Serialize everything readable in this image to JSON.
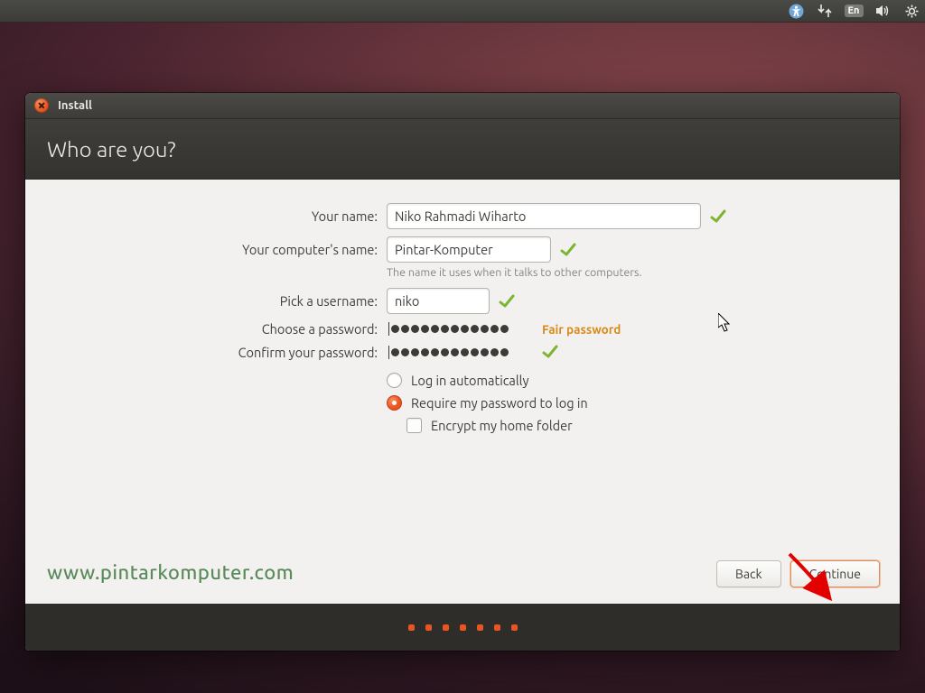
{
  "panel": {
    "lang": "En"
  },
  "window": {
    "title": "Install",
    "header": "Who are you?"
  },
  "form": {
    "name_label": "Your name:",
    "name_value": "Niko Rahmadi Wiharto",
    "hostname_label": "Your computer's name:",
    "hostname_value": "Pintar-Komputer",
    "hostname_helper": "The name it uses when it talks to other computers.",
    "username_label": "Pick a username:",
    "username_value": "niko",
    "password_label": "Choose a password:",
    "password_dots": 12,
    "password_strength": "Fair password",
    "confirm_label": "Confirm your password:",
    "confirm_dots": 12
  },
  "options": {
    "auto_login": "Log in automatically",
    "require_pw": "Require my password to log in",
    "encrypt_home": "Encrypt my home folder"
  },
  "buttons": {
    "back": "Back",
    "continue": "Continue"
  },
  "watermark": "www.pintarkomputer.com",
  "footer_dots": 7
}
